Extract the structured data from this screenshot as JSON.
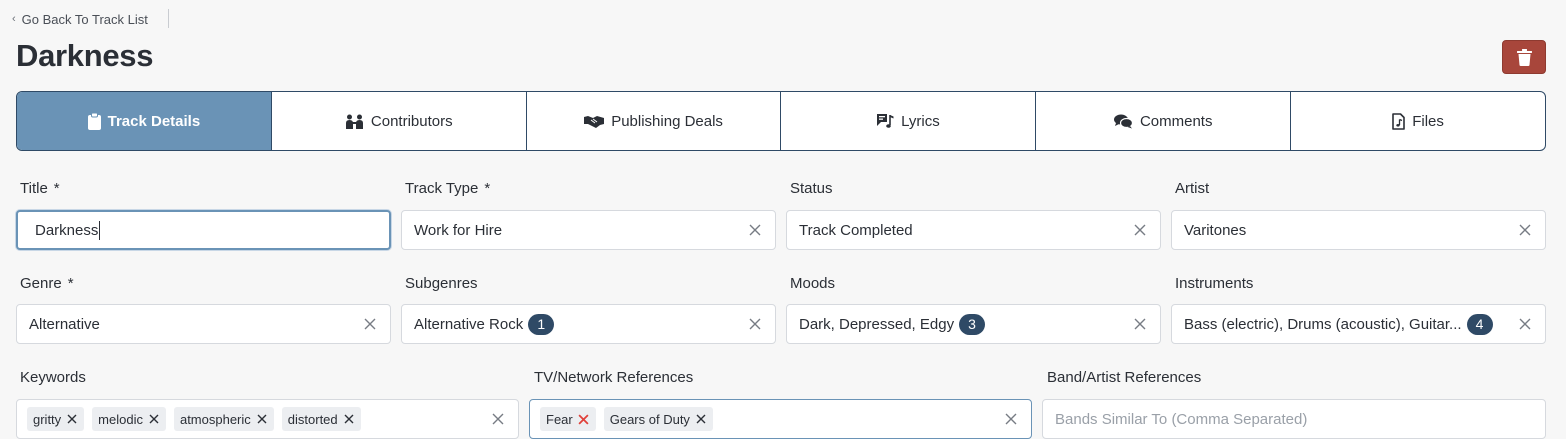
{
  "nav": {
    "back_label": "Go Back To Track List"
  },
  "page": {
    "title": "Darkness"
  },
  "tabs": [
    {
      "label": "Track Details",
      "icon": "clipboard-icon",
      "active": true
    },
    {
      "label": "Contributors",
      "icon": "people-icon",
      "active": false
    },
    {
      "label": "Publishing Deals",
      "icon": "handshake-icon",
      "active": false
    },
    {
      "label": "Lyrics",
      "icon": "lyrics-icon",
      "active": false
    },
    {
      "label": "Comments",
      "icon": "comments-icon",
      "active": false
    },
    {
      "label": "Files",
      "icon": "music-file-icon",
      "active": false
    }
  ],
  "fields": {
    "title": {
      "label": "Title",
      "required": "*",
      "value": "Darkness"
    },
    "track_type": {
      "label": "Track Type",
      "required": "*",
      "value": "Work for Hire"
    },
    "status": {
      "label": "Status",
      "value": "Track Completed"
    },
    "artist": {
      "label": "Artist",
      "value": "Varitones"
    },
    "genre": {
      "label": "Genre",
      "required": "*",
      "value": "Alternative"
    },
    "subgenres": {
      "label": "Subgenres",
      "value": "Alternative Rock",
      "count": "1"
    },
    "moods": {
      "label": "Moods",
      "value": "Dark, Depressed, Edgy",
      "count": "3"
    },
    "instruments": {
      "label": "Instruments",
      "value": "Bass (electric), Drums (acoustic), Guitar...",
      "count": "4"
    },
    "keywords": {
      "label": "Keywords",
      "chips": [
        "gritty",
        "melodic",
        "atmospheric",
        "distorted"
      ]
    },
    "tv_refs": {
      "label": "TV/Network References",
      "chips": [
        "Fear",
        "Gears of Duty"
      ]
    },
    "band_refs": {
      "label": "Band/Artist References",
      "placeholder": "Bands Similar To (Comma Separated)"
    }
  },
  "colors": {
    "accent": "#6a93b6",
    "navy": "#2f4a66",
    "danger": "#a8463b",
    "chip_remove_red": "#e0403a"
  }
}
